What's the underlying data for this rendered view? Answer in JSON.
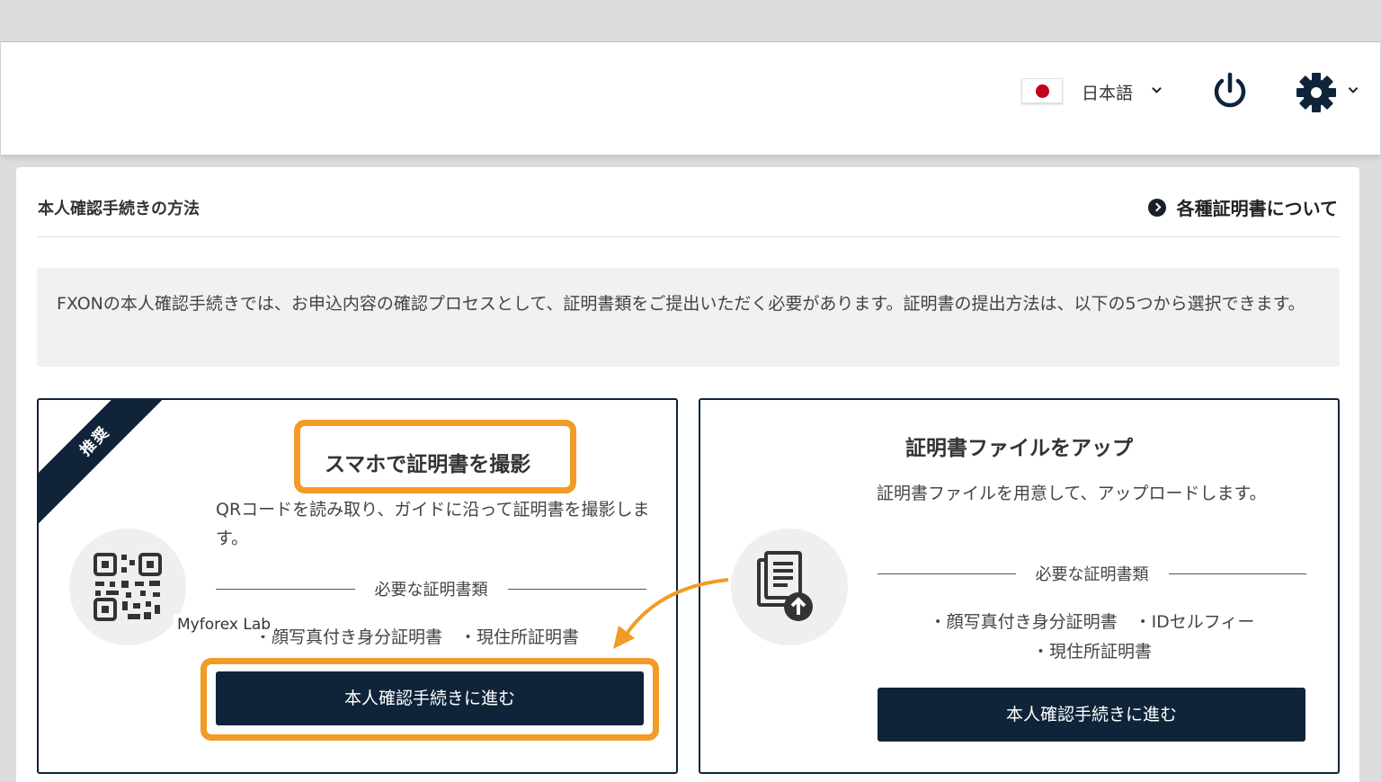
{
  "header": {
    "language_label": "日本語",
    "icons": {
      "flag": "japan-flag-icon",
      "language_chevron": "chevron-down-icon",
      "power": "power-icon",
      "settings": "gear-icon",
      "settings_chevron": "chevron-down-icon"
    }
  },
  "section": {
    "title": "本人確認手続きの方法",
    "about_link": "各種証明書について",
    "info_text": "FXONの本人確認手続きでは、お申込内容の確認プロセスとして、証明書類をご提出いただく必要があります。証明書の提出方法は、以下の5つから選択できます。"
  },
  "cards": [
    {
      "badge": "推奨",
      "title": "スマホで証明書を撮影",
      "description": "QRコードを読み取り、ガイドに沿って証明書を撮影します。",
      "required_label": "必要な証明書類",
      "documents_line1": "・顔写真付き身分証明書　・現住所証明書",
      "button": "本人確認手続きに進む",
      "icon": "qr-code-icon"
    },
    {
      "title": "証明書ファイルをアップ",
      "description": "証明書ファイルを用意して、アップロードします。",
      "required_label": "必要な証明書類",
      "documents_line1": "・顔写真付き身分証明書　・IDセルフィー",
      "documents_line2": "・現住所証明書",
      "button": "本人確認手続きに進む",
      "icon": "document-upload-icon"
    }
  ],
  "watermark": "Myforex Lab",
  "colors": {
    "navy": "#0f2439",
    "highlight": "#f29b26",
    "flag_red": "#c4001a"
  }
}
